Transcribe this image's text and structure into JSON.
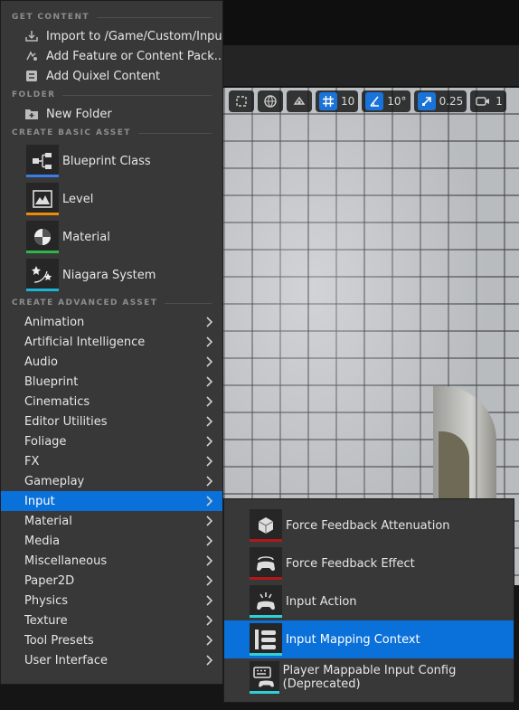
{
  "menu": {
    "sections": {
      "get_content": "GET CONTENT",
      "folder": "FOLDER",
      "create_basic": "CREATE BASIC ASSET",
      "create_advanced": "CREATE ADVANCED ASSET"
    },
    "get_content_items": [
      {
        "label": "Import to /Game/Custom/Input...",
        "icon": "import-icon"
      },
      {
        "label": "Add Feature or Content Pack...",
        "icon": "feature-pack-icon"
      },
      {
        "label": "Add Quixel Content",
        "icon": "quixel-icon"
      }
    ],
    "folder_items": [
      {
        "label": "New Folder",
        "icon": "new-folder-icon"
      }
    ],
    "basic_assets": [
      {
        "label": "Blueprint Class",
        "icon": "blueprint-class-icon",
        "color": "#3b7ce6"
      },
      {
        "label": "Level",
        "icon": "level-icon",
        "color": "#f08a0b"
      },
      {
        "label": "Material",
        "icon": "material-icon",
        "color": "#2fb54a"
      },
      {
        "label": "Niagara System",
        "icon": "niagara-system-icon",
        "color": "#19b3d9"
      }
    ],
    "advanced_categories": [
      "Animation",
      "Artificial Intelligence",
      "Audio",
      "Blueprint",
      "Cinematics",
      "Editor Utilities",
      "Foliage",
      "FX",
      "Gameplay",
      "Input",
      "Material",
      "Media",
      "Miscellaneous",
      "Paper2D",
      "Physics",
      "Texture",
      "Tool Presets",
      "User Interface"
    ],
    "highlighted_category": "Input"
  },
  "submenu": {
    "items": [
      {
        "label": "Force Feedback Attenuation",
        "icon": "force-feedback-attenuation-icon",
        "color": "#b21818"
      },
      {
        "label": "Force Feedback Effect",
        "icon": "force-feedback-effect-icon",
        "color": "#b21818"
      },
      {
        "label": "Input Action",
        "icon": "input-action-icon",
        "color": "#2fd0d9"
      },
      {
        "label": "Input Mapping Context",
        "icon": "input-mapping-context-icon",
        "color": "#2fd0d9"
      },
      {
        "label": "Player Mappable Input Config (Deprecated)",
        "icon": "player-mappable-config-icon",
        "color": "#2fd0d9"
      }
    ],
    "highlighted": "Input Mapping Context"
  },
  "viewport_toolbar": {
    "grid_snap": "10",
    "rotation_snap": "10°",
    "scale_snap": "0.25",
    "camera_speed": "1"
  },
  "colors": {
    "accent": "#0a70da",
    "menu_bg": "#383838"
  }
}
